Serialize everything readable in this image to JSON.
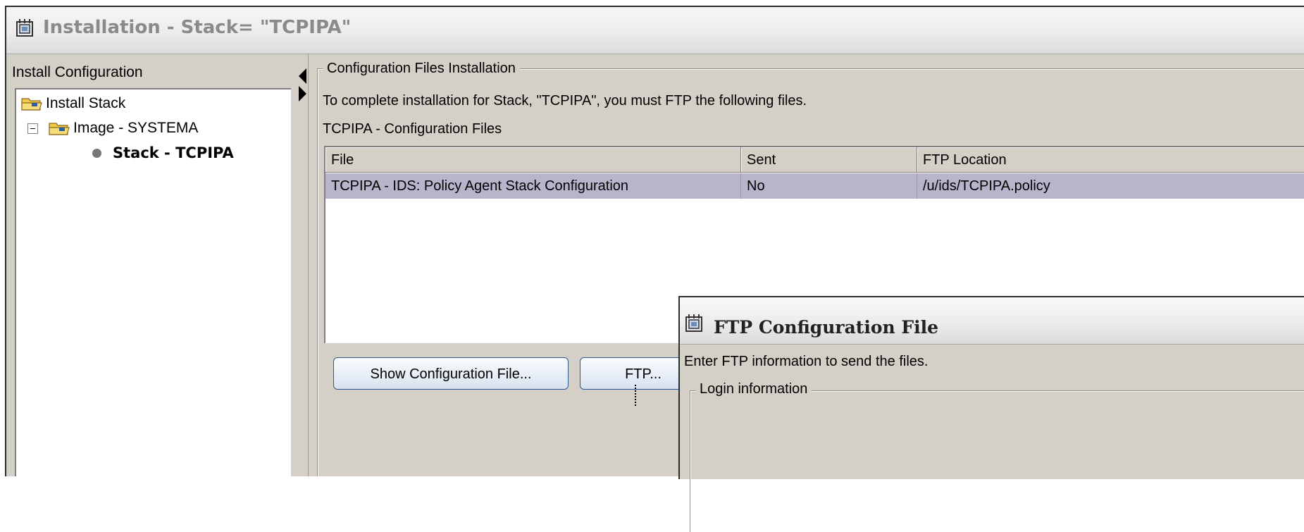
{
  "window": {
    "title": "Installation - Stack= \"TCPIPA\"",
    "icon": "app-window-icon"
  },
  "left_panel": {
    "label": "Install Configuration",
    "tree": [
      {
        "label": "Install Stack",
        "icon": "folder-open-icon"
      },
      {
        "label": "Image - SYSTEMA",
        "icon": "folder-open-icon",
        "expanded": true
      },
      {
        "label": "Stack - TCPIPA",
        "icon": "bullet-icon",
        "selected": true
      }
    ]
  },
  "main": {
    "group_title": "Configuration Files Installation",
    "instruction": "To complete installation for Stack, \"TCPIPA\", you must FTP the following files.",
    "subtitle": "TCPIPA - Configuration Files",
    "table": {
      "columns": [
        "File",
        "Sent",
        "FTP Location"
      ],
      "rows": [
        [
          "TCPIPA - IDS: Policy Agent Stack Configuration",
          "No",
          "/u/ids/TCPIPA.policy"
        ]
      ]
    },
    "buttons": {
      "show_config": "Show Configuration File...",
      "ftp": "FTP..."
    }
  },
  "dialog": {
    "title": "FTP Configuration File",
    "instruction": "Enter FTP information to send the files.",
    "login_group": "Login information"
  },
  "colors": {
    "window_bg": "#d4d0c8",
    "selected_row": "#b8b4cc",
    "button_border": "#2b5a8e"
  }
}
